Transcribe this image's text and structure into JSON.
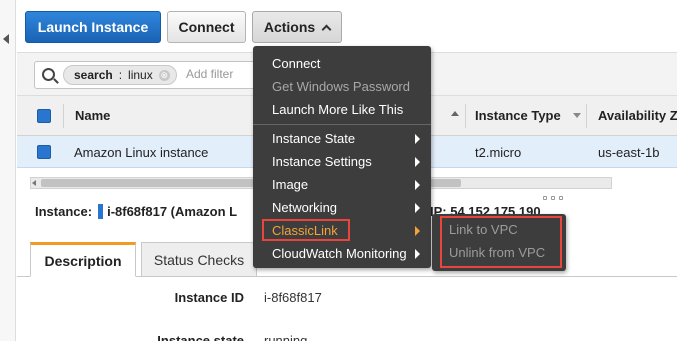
{
  "toolbar": {
    "launch_label": "Launch Instance",
    "connect_label": "Connect",
    "actions_label": "Actions"
  },
  "search": {
    "token_key": "search",
    "token_sep": ":",
    "token_value": "linux",
    "token_close": "⊗",
    "placeholder": "Add filter"
  },
  "table": {
    "columns": [
      "Name",
      "Instance Type",
      "Availability Z"
    ],
    "rows": [
      {
        "name": "Amazon Linux instance",
        "instance_type": "t2.micro",
        "availability_zone": "us-east-1b"
      }
    ]
  },
  "instance_panel": {
    "label": "Instance:",
    "id_text": "i-8f68f817 (Amazon L",
    "ip_text": "IP: 54.152.175.190"
  },
  "tabs": [
    "Description",
    "Status Checks"
  ],
  "details": [
    {
      "label": "Instance ID",
      "value": "i-8f68f817"
    },
    {
      "label": "Instance state",
      "value": "running"
    }
  ],
  "actions_menu": {
    "items": [
      {
        "label": "Connect",
        "enabled": true
      },
      {
        "label": "Get Windows Password",
        "enabled": false
      },
      {
        "label": "Launch More Like This",
        "enabled": true
      },
      {
        "label": "Instance State",
        "submenu": true
      },
      {
        "label": "Instance Settings",
        "submenu": true
      },
      {
        "label": "Image",
        "submenu": true
      },
      {
        "label": "Networking",
        "submenu": true
      },
      {
        "label": "ClassicLink",
        "submenu": true,
        "highlighted": true
      },
      {
        "label": "CloudWatch Monitoring",
        "submenu": true
      }
    ]
  },
  "classiclink_submenu": {
    "items": [
      {
        "label": "Link to VPC",
        "enabled": false
      },
      {
        "label": "Unlink from VPC",
        "enabled": false
      }
    ]
  },
  "colors": {
    "primary_button": "#1f6fc5",
    "menu_background": "#3d3d3d",
    "highlight_border": "#e8463c",
    "classiclink_text": "#f3a33b",
    "active_tab_accent": "#f19a26"
  }
}
